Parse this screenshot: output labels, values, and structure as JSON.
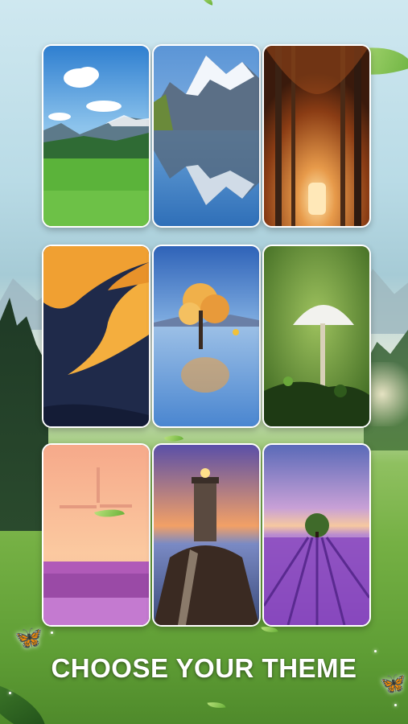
{
  "screen": {
    "title": "CHOOSE YOUR THEME"
  },
  "themes": [
    {
      "name": "alpine-meadow",
      "accent": "#3f8fd8"
    },
    {
      "name": "mountain-lake",
      "accent": "#5a9ad6"
    },
    {
      "name": "autumn-forest",
      "accent": "#c06a2a"
    },
    {
      "name": "desert-dunes",
      "accent": "#e8a23a"
    },
    {
      "name": "lone-tree-lake",
      "accent": "#e9a03a"
    },
    {
      "name": "white-mushroom",
      "accent": "#6f9a3a"
    },
    {
      "name": "windmill-sunset",
      "accent": "#f2b08a"
    },
    {
      "name": "lighthouse",
      "accent": "#7a6ab8"
    },
    {
      "name": "lavender-field",
      "accent": "#8a5ac8"
    }
  ],
  "decorations": [
    "leaf",
    "butterfly-icon",
    "sparkle"
  ]
}
